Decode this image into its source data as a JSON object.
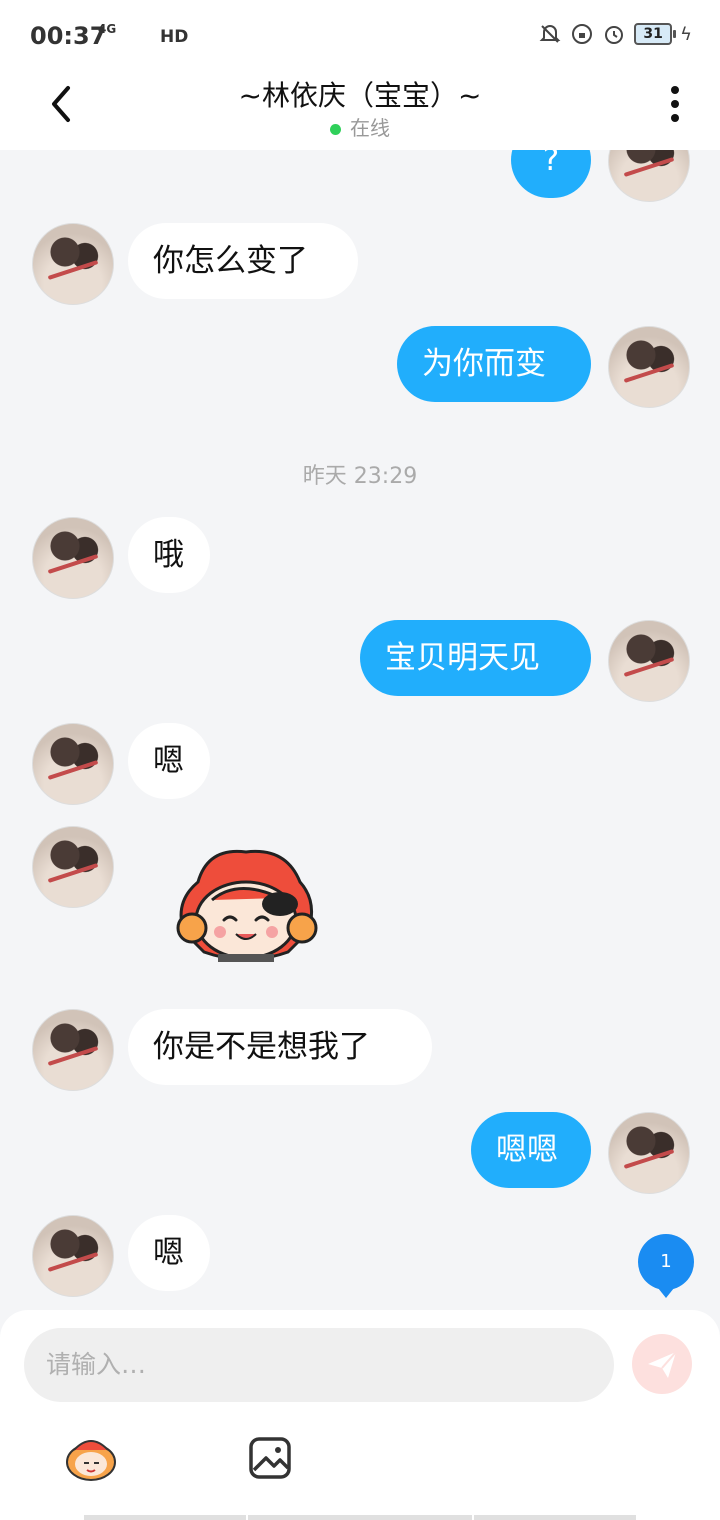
{
  "status_bar": {
    "time": "00:37",
    "network": "4G",
    "hd": "HD",
    "battery": "31"
  },
  "header": {
    "title": "~林依庆（宝宝）~",
    "status": "在线"
  },
  "messages": [
    {
      "side": "out",
      "text": "?"
    },
    {
      "side": "in",
      "text": "你怎么变了"
    },
    {
      "side": "out",
      "text": "为你而变"
    },
    {
      "side": "time",
      "text": "昨天 23:29"
    },
    {
      "side": "in",
      "text": "哦"
    },
    {
      "side": "out",
      "text": "宝贝明天见"
    },
    {
      "side": "in",
      "text": "嗯"
    },
    {
      "side": "in",
      "sticker": "cartoon-character-sticker"
    },
    {
      "side": "in",
      "text": "你是不是想我了"
    },
    {
      "side": "out",
      "text": "嗯嗯"
    },
    {
      "side": "in",
      "text": "嗯"
    }
  ],
  "unread_badge": "1",
  "composer": {
    "placeholder": "请输入…"
  },
  "toolbar_icons": [
    "emoji-sticker-icon",
    "image-icon"
  ],
  "colors": {
    "accent_blue": "#21aefc",
    "online_green": "#2fd05a",
    "badge_blue": "#1a8cf2"
  }
}
